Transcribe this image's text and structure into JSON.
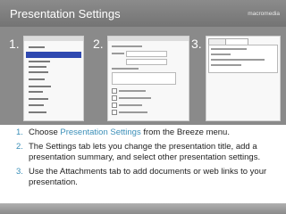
{
  "header": {
    "title": "Presentation Settings",
    "brand": "macromedia"
  },
  "screenshots": {
    "labels": [
      "1.",
      "2.",
      "3."
    ]
  },
  "steps": [
    {
      "number": "1.",
      "before": "Choose ",
      "link": "Presentation Settings",
      "after": " from the Breeze menu."
    },
    {
      "number": "2.",
      "text": "The Settings tab lets you change the presentation title, add a presentation summary, and select other presentation settings."
    },
    {
      "number": "3.",
      "text": "Use the Attachments tab to add documents or web links to your presentation."
    }
  ],
  "colors": {
    "header": "#808080",
    "band": "#8a8a8a",
    "accent": "#3b8fb8",
    "menu_highlight": "#2f49b0"
  }
}
